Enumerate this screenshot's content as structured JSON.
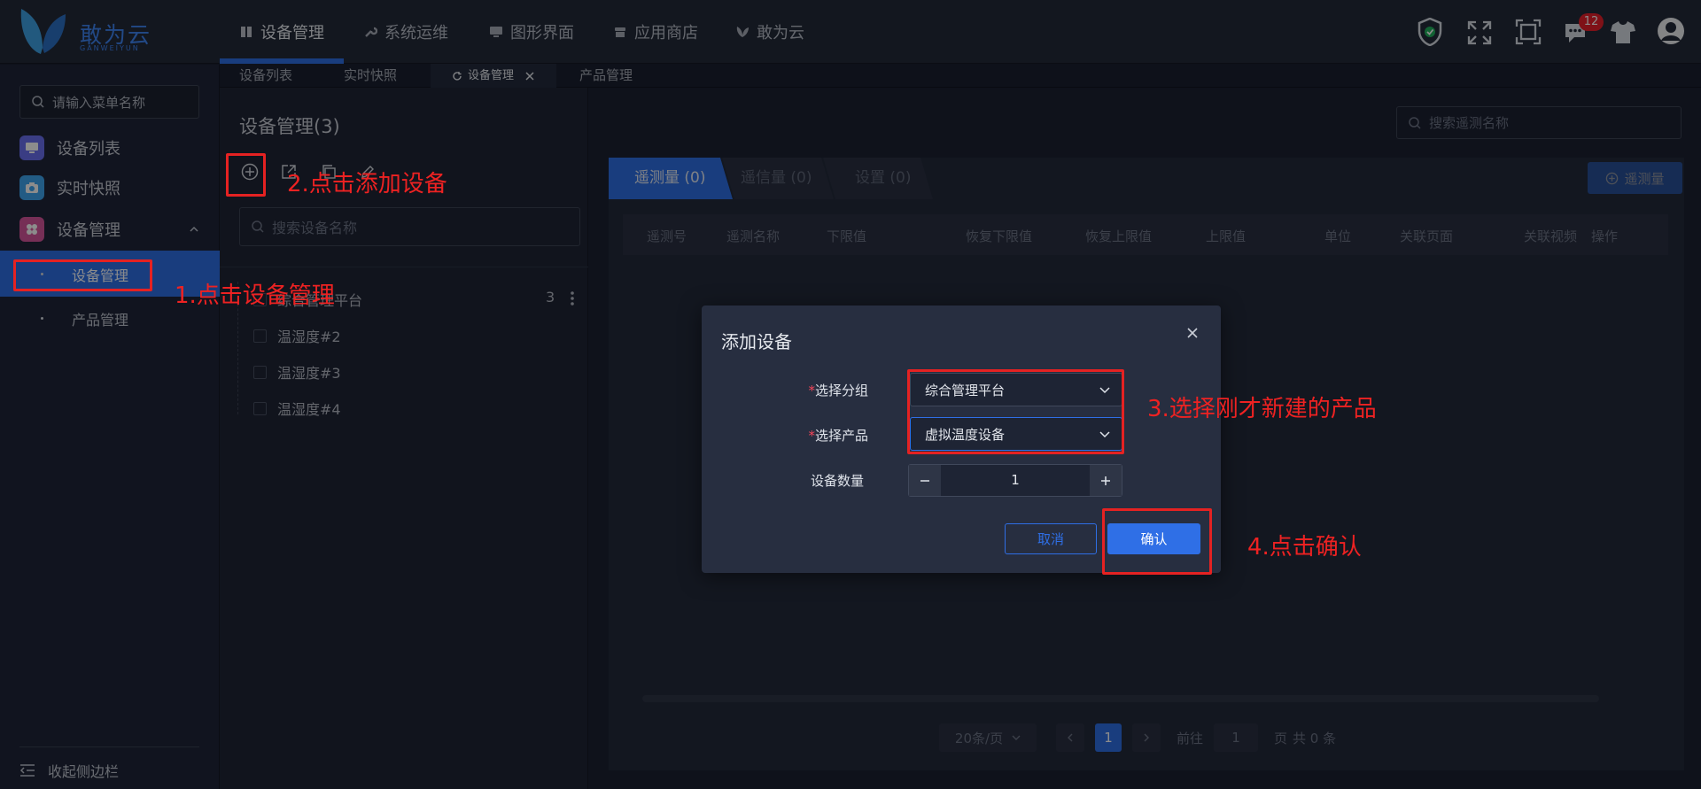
{
  "brand": {
    "name": "敢为云",
    "sub": "GANWEIYUN"
  },
  "nav": [
    {
      "label": "设备管理",
      "icon": "book-icon"
    },
    {
      "label": "系统运维",
      "icon": "wrench-icon"
    },
    {
      "label": "图形界面",
      "icon": "monitor-icon"
    },
    {
      "label": "应用商店",
      "icon": "store-icon"
    },
    {
      "label": "敢为云",
      "icon": "butterfly-icon"
    }
  ],
  "header": {
    "notification_count": "12"
  },
  "tabs": [
    "设备列表",
    "实时快照",
    "设备管理",
    "产品管理"
  ],
  "sidebar": {
    "search_placeholder": "请输入菜单名称",
    "items": [
      {
        "label": "设备列表",
        "icon": "monitor-icon",
        "color": "#6a6ff0"
      },
      {
        "label": "实时快照",
        "icon": "camera-icon",
        "color": "#3ea6f0"
      },
      {
        "label": "设备管理",
        "icon": "grid-icon",
        "color": "#d7569d"
      }
    ],
    "subitems": [
      "设备管理",
      "产品管理"
    ],
    "collapse_label": "收起侧边栏"
  },
  "device_panel": {
    "title": "设备管理(3)",
    "search_placeholder": "搜索设备名称",
    "group": {
      "name": "综合管理平台",
      "count": "3"
    },
    "devices": [
      "温湿度#2",
      "温湿度#3",
      "温湿度#4"
    ]
  },
  "telemetry": {
    "search_placeholder": "搜索遥测名称",
    "tabs": [
      "遥测量 (0)",
      "遥信量 (0)",
      "设置 (0)"
    ],
    "add_label": "遥测量",
    "columns": [
      "遥测号",
      "遥测名称",
      "下限值",
      "恢复下限值",
      "恢复上限值",
      "上限值",
      "单位",
      "关联页面",
      "关联视频",
      "操作"
    ]
  },
  "pagination": {
    "page_size": "20条/页",
    "current_page": "1",
    "goto_label": "前往",
    "goto_value": "1",
    "page_unit": "页",
    "total": "共 0 条"
  },
  "modal": {
    "title": "添加设备",
    "group_label": "选择分组",
    "group_value": "综合管理平台",
    "product_label": "选择产品",
    "product_value": "虚拟温度设备",
    "count_label": "设备数量",
    "count_value": "1",
    "cancel_label": "取消",
    "confirm_label": "确认"
  },
  "annotations": [
    "1.点击设备管理",
    "2.点击添加设备",
    "3.选择刚才新建的产品",
    "4.点击确认"
  ],
  "colors": {
    "accent": "#2f6fe6",
    "annotation": "#ee2222",
    "bg": "#1b2030"
  }
}
